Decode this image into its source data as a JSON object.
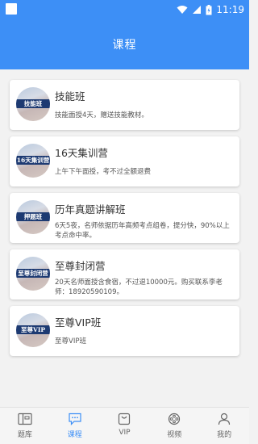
{
  "status": {
    "time": "11:19"
  },
  "header": {
    "title": "课程"
  },
  "courses": [
    {
      "thumb_text": "技能班",
      "title": "技能班",
      "desc": "技能面授4天，赠送技能教材。"
    },
    {
      "thumb_text": "16天集训营",
      "title": "16天集训营",
      "desc": "上午下午面授，考不过全额退费"
    },
    {
      "thumb_text": "押题班",
      "title": "历年真题讲解班",
      "desc": "6天5夜，名师依据历年高频考点组卷，提分快，90%以上考点命中率。"
    },
    {
      "thumb_text": "至尊封闭营",
      "title": "至尊封闭营",
      "desc": "20天名师面授含食宿，不过退10000元。购买联系李老师：18920590109。"
    },
    {
      "thumb_text": "至尊VIP",
      "title": "至尊VIP班",
      "desc": "至尊VIP班"
    }
  ],
  "tabs": [
    {
      "label": "题库",
      "icon": "question-bank-icon"
    },
    {
      "label": "课程",
      "icon": "course-chat-icon"
    },
    {
      "label": "VIP",
      "icon": "vip-bag-icon"
    },
    {
      "label": "视频",
      "icon": "video-film-icon"
    },
    {
      "label": "我的",
      "icon": "profile-icon"
    }
  ],
  "colors": {
    "primary": "#3d8ff6",
    "background": "#f2f2f2"
  }
}
